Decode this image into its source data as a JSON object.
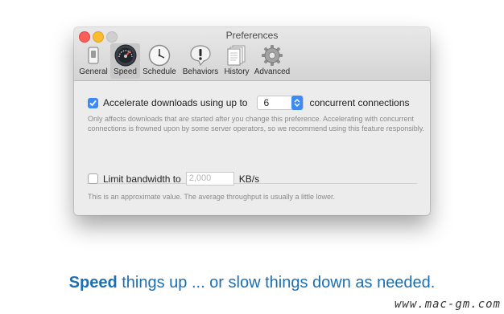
{
  "window": {
    "title": "Preferences"
  },
  "toolbar": {
    "items": [
      {
        "label": "General",
        "icon": "switch-icon"
      },
      {
        "label": "Speed",
        "icon": "speedometer-icon",
        "selected": true
      },
      {
        "label": "Schedule",
        "icon": "clock-icon"
      },
      {
        "label": "Behaviors",
        "icon": "alert-icon"
      },
      {
        "label": "History",
        "icon": "documents-icon"
      },
      {
        "label": "Advanced",
        "icon": "gear-icon"
      }
    ]
  },
  "speed": {
    "accelerate": {
      "checked": true,
      "label": "Accelerate downloads using up to",
      "value": "6",
      "suffix": "concurrent connections",
      "help": "Only affects downloads that are started after you change this preference. Accelerating with concurrent connections is frowned upon by some server operators, so we recommend using this feature responsibly."
    },
    "limit": {
      "checked": false,
      "label": "Limit bandwidth to",
      "placeholder": "2,000",
      "unit": "KB/s",
      "help": "This is an approximate value. The average throughput is usually a little lower."
    }
  },
  "tagline": {
    "bold": "Speed",
    "rest": " things up ... or slow things down as needed."
  },
  "watermark": "www.mac-gm.com",
  "colors": {
    "accent": "#3b8af7",
    "tagline": "#1c6fb3"
  }
}
